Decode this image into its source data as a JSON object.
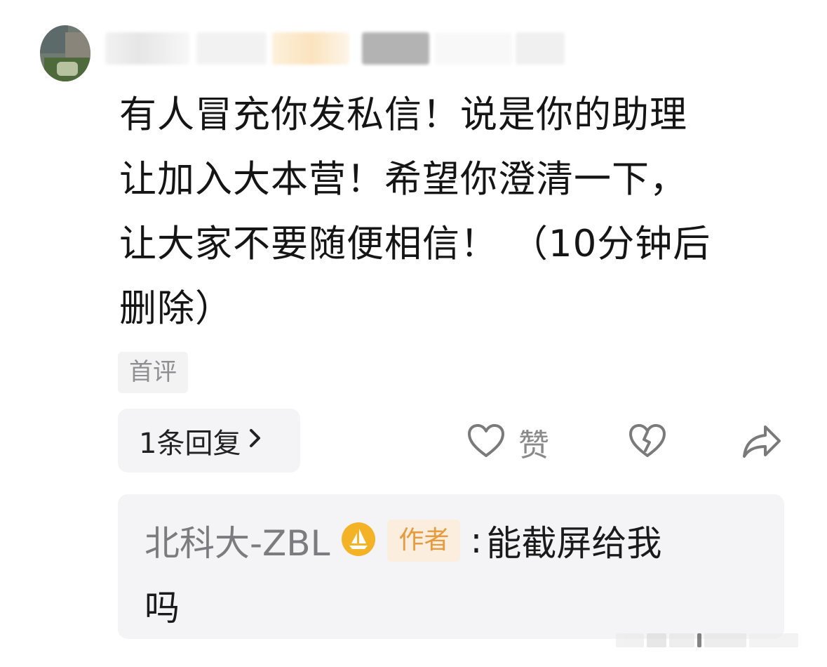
{
  "comment": {
    "text": "有人冒充你发私信！说是你的助理\n让加入大本营！希望你澄清一下，\n让大家不要随便相信！ （10分钟后\n删除）",
    "badge": "首评"
  },
  "actions": {
    "reply_count_label": "1条回复",
    "like_label": "赞",
    "like_icon": "heart-outline-icon",
    "dislike_icon": "broken-heart-icon",
    "share_icon": "share-arrow-icon"
  },
  "reply": {
    "author": "北科大-ZBL",
    "author_tag": "作者",
    "colon": ":",
    "content_line1": "能截屏给我",
    "content_line2": "吗",
    "level_icon": "gold-sailboat-badge-icon"
  },
  "colors": {
    "author_tag_bg": "#fbeede",
    "author_tag_text": "#e89b3c",
    "level_badge": "#f4b227"
  }
}
